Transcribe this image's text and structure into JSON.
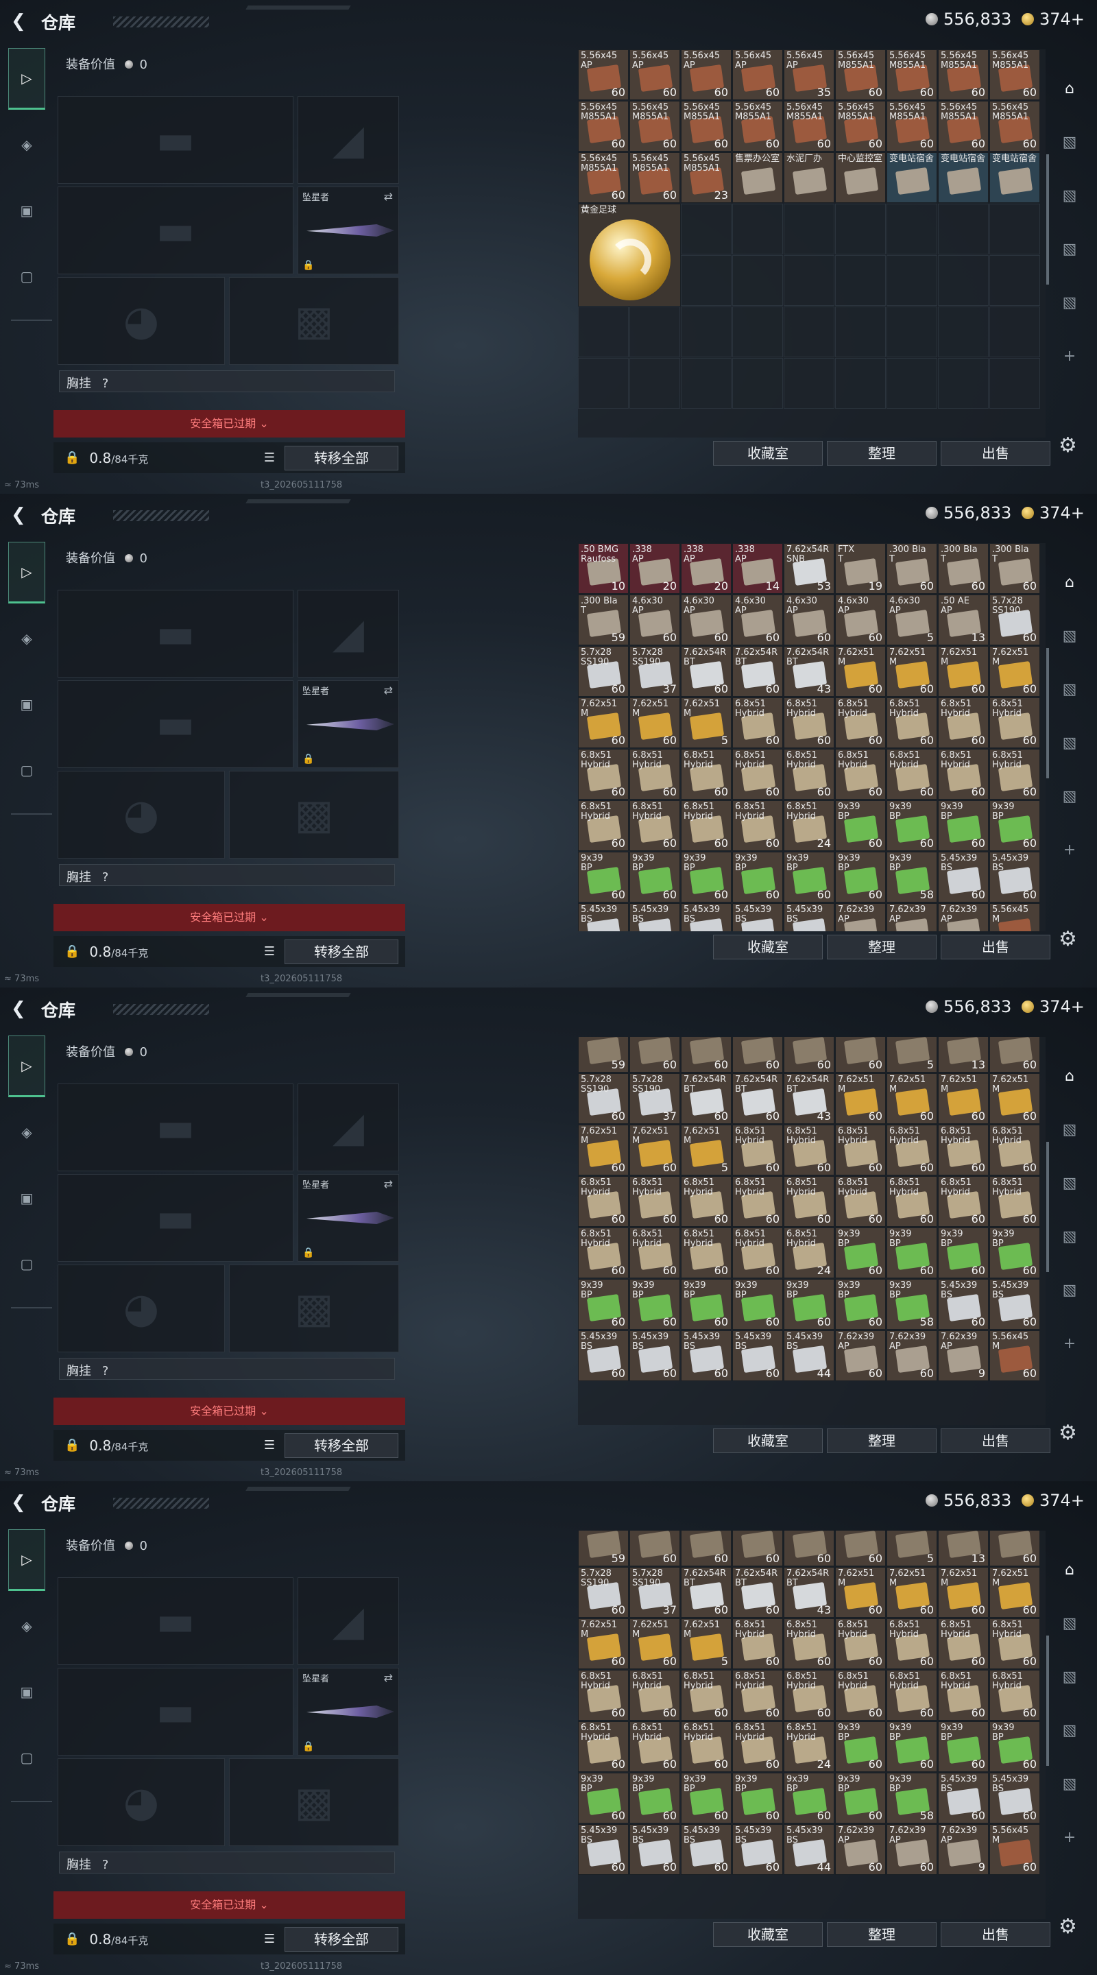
{
  "top": {
    "title": "仓库",
    "silver": "556,833",
    "gold": "374+"
  },
  "equip": {
    "value_label": "装备价值",
    "value": "0",
    "knife_label": "坠星者",
    "chest_label": "胸挂",
    "chest_hint": "?",
    "safe_label": "安全箱已过期",
    "weight": "0.8",
    "weight_max": "/84千克",
    "move_all": "转移全部"
  },
  "actions": {
    "collect": "收藏室",
    "arrange": "整理",
    "sell": "出售"
  },
  "status": {
    "ping": "73ms",
    "build": "t3_202605111758"
  },
  "icons": {
    "back": "chevron-left-icon",
    "weapon": "gun-icon",
    "armor": "shield-icon",
    "backpack": "backpack-icon",
    "case": "briefcase-icon",
    "settings": "gear-icon"
  },
  "colors": {
    "safe_bg": "#6d1b1f",
    "safe_text": "#ff7d7d",
    "accent": "#4ec28f"
  },
  "panels": [
    {
      "stash": [
        [
          {
            "n": "5.56x45\nAP",
            "c": "60"
          },
          {
            "n": "5.56x45\nAP",
            "c": "60"
          },
          {
            "n": "5.56x45\nAP",
            "c": "60"
          },
          {
            "n": "5.56x45\nAP",
            "c": "60"
          },
          {
            "n": "5.56x45\nAP",
            "c": "35"
          },
          {
            "n": "5.56x45\nM855A1",
            "c": "60"
          },
          {
            "n": "5.56x45\nM855A1",
            "c": "60"
          },
          {
            "n": "5.56x45\nM855A1",
            "c": "60"
          },
          {
            "n": "5.56x45\nM855A1",
            "c": "60"
          }
        ],
        [
          {
            "n": "5.56x45\nM855A1",
            "c": "60"
          },
          {
            "n": "5.56x45\nM855A1",
            "c": "60"
          },
          {
            "n": "5.56x45\nM855A1",
            "c": "60"
          },
          {
            "n": "5.56x45\nM855A1",
            "c": "60"
          },
          {
            "n": "5.56x45\nM855A1",
            "c": "60"
          },
          {
            "n": "5.56x45\nM855A1",
            "c": "60"
          },
          {
            "n": "5.56x45\nM855A1",
            "c": "60"
          },
          {
            "n": "5.56x45\nM855A1",
            "c": "60"
          },
          {
            "n": "5.56x45\nM855A1",
            "c": "60"
          }
        ],
        [
          {
            "n": "5.56x45\nM855A1",
            "c": "60"
          },
          {
            "n": "5.56x45\nM855A1",
            "c": "60"
          },
          {
            "n": "5.56x45\nM855A1",
            "c": "23"
          },
          {
            "n": "售票办公室",
            "c": ""
          },
          {
            "n": "水泥厂办",
            "c": ""
          },
          {
            "n": "中心监控室",
            "c": ""
          },
          {
            "n": "变电站宿舍",
            "c": ""
          },
          {
            "n": "变电站宿舍",
            "c": ""
          },
          {
            "n": "变电站宿舍",
            "c": ""
          }
        ]
      ],
      "ball_label": "黄金足球"
    },
    {
      "stash": [
        [
          {
            "n": ".50 BMG\nRaufoss",
            "c": "10"
          },
          {
            "n": ".338\nAP",
            "c": "20"
          },
          {
            "n": ".338\nAP",
            "c": "20"
          },
          {
            "n": ".338\nAP",
            "c": "14"
          },
          {
            "n": "7.62x54R\nSNB",
            "c": "53"
          },
          {
            "n": "FTX\nT",
            "c": "19"
          },
          {
            "n": ".300 Bla\nT",
            "c": "60"
          },
          {
            "n": ".300 Bla\nT",
            "c": "60"
          },
          {
            "n": ".300 Bla\nT",
            "c": "60"
          }
        ],
        [
          {
            "n": ".300 Bla\nT",
            "c": "59"
          },
          {
            "n": "4.6x30\nAP",
            "c": "60"
          },
          {
            "n": "4.6x30\nAP",
            "c": "60"
          },
          {
            "n": "4.6x30\nAP",
            "c": "60"
          },
          {
            "n": "4.6x30\nAP",
            "c": "60"
          },
          {
            "n": "4.6x30\nAP",
            "c": "60"
          },
          {
            "n": "4.6x30\nAP",
            "c": "5"
          },
          {
            "n": ".50 AE\nAP",
            "c": "13"
          },
          {
            "n": "5.7x28\nSS190",
            "c": "60"
          }
        ],
        [
          {
            "n": "5.7x28\nSS190",
            "c": "60"
          },
          {
            "n": "5.7x28\nSS190",
            "c": "37"
          },
          {
            "n": "7.62x54R\nBT",
            "c": "60"
          },
          {
            "n": "7.62x54R\nBT",
            "c": "60"
          },
          {
            "n": "7.62x54R\nBT",
            "c": "43"
          },
          {
            "n": "7.62x51\nM",
            "c": "60"
          },
          {
            "n": "7.62x51\nM",
            "c": "60"
          },
          {
            "n": "7.62x51\nM",
            "c": "60"
          },
          {
            "n": "7.62x51\nM",
            "c": "60"
          }
        ],
        [
          {
            "n": "7.62x51\nM",
            "c": "60"
          },
          {
            "n": "7.62x51\nM",
            "c": "60"
          },
          {
            "n": "7.62x51\nM",
            "c": "5"
          },
          {
            "n": "6.8x51\nHybrid",
            "c": "60"
          },
          {
            "n": "6.8x51\nHybrid",
            "c": "60"
          },
          {
            "n": "6.8x51\nHybrid",
            "c": "60"
          },
          {
            "n": "6.8x51\nHybrid",
            "c": "60"
          },
          {
            "n": "6.8x51\nHybrid",
            "c": "60"
          },
          {
            "n": "6.8x51\nHybrid",
            "c": "60"
          }
        ],
        [
          {
            "n": "6.8x51\nHybrid",
            "c": "60"
          },
          {
            "n": "6.8x51\nHybrid",
            "c": "60"
          },
          {
            "n": "6.8x51\nHybrid",
            "c": "60"
          },
          {
            "n": "6.8x51\nHybrid",
            "c": "60"
          },
          {
            "n": "6.8x51\nHybrid",
            "c": "60"
          },
          {
            "n": "6.8x51\nHybrid",
            "c": "60"
          },
          {
            "n": "6.8x51\nHybrid",
            "c": "60"
          },
          {
            "n": "6.8x51\nHybrid",
            "c": "60"
          },
          {
            "n": "6.8x51\nHybrid",
            "c": "60"
          }
        ],
        [
          {
            "n": "6.8x51\nHybrid",
            "c": "60"
          },
          {
            "n": "6.8x51\nHybrid",
            "c": "60"
          },
          {
            "n": "6.8x51\nHybrid",
            "c": "60"
          },
          {
            "n": "6.8x51\nHybrid",
            "c": "60"
          },
          {
            "n": "6.8x51\nHybrid",
            "c": "24"
          },
          {
            "n": "9x39\nBP",
            "c": "60"
          },
          {
            "n": "9x39\nBP",
            "c": "60"
          },
          {
            "n": "9x39\nBP",
            "c": "60"
          },
          {
            "n": "9x39\nBP",
            "c": "60"
          }
        ],
        [
          {
            "n": "9x39\nBP",
            "c": "60"
          },
          {
            "n": "9x39\nBP",
            "c": "60"
          },
          {
            "n": "9x39\nBP",
            "c": "60"
          },
          {
            "n": "9x39\nBP",
            "c": "60"
          },
          {
            "n": "9x39\nBP",
            "c": "60"
          },
          {
            "n": "9x39\nBP",
            "c": "60"
          },
          {
            "n": "9x39\nBP",
            "c": "58"
          },
          {
            "n": "5.45x39\nBS",
            "c": "60"
          },
          {
            "n": "5.45x39\nBS",
            "c": "60"
          }
        ],
        [
          {
            "n": "5.45x39\nBS",
            "c": ""
          },
          {
            "n": "5.45x39\nBS",
            "c": ""
          },
          {
            "n": "5.45x39\nBS",
            "c": ""
          },
          {
            "n": "5.45x39\nBS",
            "c": ""
          },
          {
            "n": "5.45x39\nBS",
            "c": ""
          },
          {
            "n": "7.62x39\nAP",
            "c": ""
          },
          {
            "n": "7.62x39\nAP",
            "c": ""
          },
          {
            "n": "7.62x39\nAP",
            "c": ""
          },
          {
            "n": "5.56x45\nM",
            "c": ""
          }
        ]
      ]
    },
    {
      "stash": [
        [
          {
            "n": "",
            "c": "59"
          },
          {
            "n": "",
            "c": "60"
          },
          {
            "n": "",
            "c": "60"
          },
          {
            "n": "",
            "c": "60"
          },
          {
            "n": "",
            "c": "60"
          },
          {
            "n": "",
            "c": "60"
          },
          {
            "n": "",
            "c": "5"
          },
          {
            "n": "",
            "c": "13"
          },
          {
            "n": "",
            "c": "60"
          }
        ],
        [
          {
            "n": "5.7x28\nSS190",
            "c": "60"
          },
          {
            "n": "5.7x28\nSS190",
            "c": "37"
          },
          {
            "n": "7.62x54R\nBT",
            "c": "60"
          },
          {
            "n": "7.62x54R\nBT",
            "c": "60"
          },
          {
            "n": "7.62x54R\nBT",
            "c": "43"
          },
          {
            "n": "7.62x51\nM",
            "c": "60"
          },
          {
            "n": "7.62x51\nM",
            "c": "60"
          },
          {
            "n": "7.62x51\nM",
            "c": "60"
          },
          {
            "n": "7.62x51\nM",
            "c": "60"
          }
        ],
        [
          {
            "n": "7.62x51\nM",
            "c": "60"
          },
          {
            "n": "7.62x51\nM",
            "c": "60"
          },
          {
            "n": "7.62x51\nM",
            "c": "5"
          },
          {
            "n": "6.8x51\nHybrid",
            "c": "60"
          },
          {
            "n": "6.8x51\nHybrid",
            "c": "60"
          },
          {
            "n": "6.8x51\nHybrid",
            "c": "60"
          },
          {
            "n": "6.8x51\nHybrid",
            "c": "60"
          },
          {
            "n": "6.8x51\nHybrid",
            "c": "60"
          },
          {
            "n": "6.8x51\nHybrid",
            "c": "60"
          }
        ],
        [
          {
            "n": "6.8x51\nHybrid",
            "c": "60"
          },
          {
            "n": "6.8x51\nHybrid",
            "c": "60"
          },
          {
            "n": "6.8x51\nHybrid",
            "c": "60"
          },
          {
            "n": "6.8x51\nHybrid",
            "c": "60"
          },
          {
            "n": "6.8x51\nHybrid",
            "c": "60"
          },
          {
            "n": "6.8x51\nHybrid",
            "c": "60"
          },
          {
            "n": "6.8x51\nHybrid",
            "c": "60"
          },
          {
            "n": "6.8x51\nHybrid",
            "c": "60"
          },
          {
            "n": "6.8x51\nHybrid",
            "c": "60"
          }
        ],
        [
          {
            "n": "6.8x51\nHybrid",
            "c": "60"
          },
          {
            "n": "6.8x51\nHybrid",
            "c": "60"
          },
          {
            "n": "6.8x51\nHybrid",
            "c": "60"
          },
          {
            "n": "6.8x51\nHybrid",
            "c": "60"
          },
          {
            "n": "6.8x51\nHybrid",
            "c": "24"
          },
          {
            "n": "9x39\nBP",
            "c": "60"
          },
          {
            "n": "9x39\nBP",
            "c": "60"
          },
          {
            "n": "9x39\nBP",
            "c": "60"
          },
          {
            "n": "9x39\nBP",
            "c": "60"
          }
        ],
        [
          {
            "n": "9x39\nBP",
            "c": "60"
          },
          {
            "n": "9x39\nBP",
            "c": "60"
          },
          {
            "n": "9x39\nBP",
            "c": "60"
          },
          {
            "n": "9x39\nBP",
            "c": "60"
          },
          {
            "n": "9x39\nBP",
            "c": "60"
          },
          {
            "n": "9x39\nBP",
            "c": "60"
          },
          {
            "n": "9x39\nBP",
            "c": "58"
          },
          {
            "n": "5.45x39\nBS",
            "c": "60"
          },
          {
            "n": "5.45x39\nBS",
            "c": "60"
          }
        ],
        [
          {
            "n": "5.45x39\nBS",
            "c": "60"
          },
          {
            "n": "5.45x39\nBS",
            "c": "60"
          },
          {
            "n": "5.45x39\nBS",
            "c": "60"
          },
          {
            "n": "5.45x39\nBS",
            "c": "60"
          },
          {
            "n": "5.45x39\nBS",
            "c": "44"
          },
          {
            "n": "7.62x39\nAP",
            "c": "60"
          },
          {
            "n": "7.62x39\nAP",
            "c": "60"
          },
          {
            "n": "7.62x39\nAP",
            "c": "9"
          },
          {
            "n": "5.56x45\nM",
            "c": "60"
          }
        ]
      ]
    },
    {
      "stash": [
        [
          {
            "n": "",
            "c": "59"
          },
          {
            "n": "",
            "c": "60"
          },
          {
            "n": "",
            "c": "60"
          },
          {
            "n": "",
            "c": "60"
          },
          {
            "n": "",
            "c": "60"
          },
          {
            "n": "",
            "c": "60"
          },
          {
            "n": "",
            "c": "5"
          },
          {
            "n": "",
            "c": "13"
          },
          {
            "n": "",
            "c": "60"
          }
        ],
        [
          {
            "n": "5.7x28\nSS190",
            "c": "60"
          },
          {
            "n": "5.7x28\nSS190",
            "c": "37"
          },
          {
            "n": "7.62x54R\nBT",
            "c": "60"
          },
          {
            "n": "7.62x54R\nBT",
            "c": "60"
          },
          {
            "n": "7.62x54R\nBT",
            "c": "43"
          },
          {
            "n": "7.62x51\nM",
            "c": "60"
          },
          {
            "n": "7.62x51\nM",
            "c": "60"
          },
          {
            "n": "7.62x51\nM",
            "c": "60"
          },
          {
            "n": "7.62x51\nM",
            "c": "60"
          }
        ],
        [
          {
            "n": "7.62x51\nM",
            "c": "60"
          },
          {
            "n": "7.62x51\nM",
            "c": "60"
          },
          {
            "n": "7.62x51\nM",
            "c": "5"
          },
          {
            "n": "6.8x51\nHybrid",
            "c": "60"
          },
          {
            "n": "6.8x51\nHybrid",
            "c": "60"
          },
          {
            "n": "6.8x51\nHybrid",
            "c": "60"
          },
          {
            "n": "6.8x51\nHybrid",
            "c": "60"
          },
          {
            "n": "6.8x51\nHybrid",
            "c": "60"
          },
          {
            "n": "6.8x51\nHybrid",
            "c": "60"
          }
        ],
        [
          {
            "n": "6.8x51\nHybrid",
            "c": "60"
          },
          {
            "n": "6.8x51\nHybrid",
            "c": "60"
          },
          {
            "n": "6.8x51\nHybrid",
            "c": "60"
          },
          {
            "n": "6.8x51\nHybrid",
            "c": "60"
          },
          {
            "n": "6.8x51\nHybrid",
            "c": "60"
          },
          {
            "n": "6.8x51\nHybrid",
            "c": "60"
          },
          {
            "n": "6.8x51\nHybrid",
            "c": "60"
          },
          {
            "n": "6.8x51\nHybrid",
            "c": "60"
          },
          {
            "n": "6.8x51\nHybrid",
            "c": "60"
          }
        ],
        [
          {
            "n": "6.8x51\nHybrid",
            "c": "60"
          },
          {
            "n": "6.8x51\nHybrid",
            "c": "60"
          },
          {
            "n": "6.8x51\nHybrid",
            "c": "60"
          },
          {
            "n": "6.8x51\nHybrid",
            "c": "60"
          },
          {
            "n": "6.8x51\nHybrid",
            "c": "24"
          },
          {
            "n": "9x39\nBP",
            "c": "60"
          },
          {
            "n": "9x39\nBP",
            "c": "60"
          },
          {
            "n": "9x39\nBP",
            "c": "60"
          },
          {
            "n": "9x39\nBP",
            "c": "60"
          }
        ],
        [
          {
            "n": "9x39\nBP",
            "c": "60"
          },
          {
            "n": "9x39\nBP",
            "c": "60"
          },
          {
            "n": "9x39\nBP",
            "c": "60"
          },
          {
            "n": "9x39\nBP",
            "c": "60"
          },
          {
            "n": "9x39\nBP",
            "c": "60"
          },
          {
            "n": "9x39\nBP",
            "c": "60"
          },
          {
            "n": "9x39\nBP",
            "c": "58"
          },
          {
            "n": "5.45x39\nBS",
            "c": "60"
          },
          {
            "n": "5.45x39\nBS",
            "c": "60"
          }
        ],
        [
          {
            "n": "5.45x39\nBS",
            "c": "60"
          },
          {
            "n": "5.45x39\nBS",
            "c": "60"
          },
          {
            "n": "5.45x39\nBS",
            "c": "60"
          },
          {
            "n": "5.45x39\nBS",
            "c": "60"
          },
          {
            "n": "5.45x39\nBS",
            "c": "44"
          },
          {
            "n": "7.62x39\nAP",
            "c": "60"
          },
          {
            "n": "7.62x39\nAP",
            "c": "60"
          },
          {
            "n": "7.62x39\nAP",
            "c": "9"
          },
          {
            "n": "5.56x45\nM",
            "c": "60"
          }
        ]
      ]
    }
  ]
}
